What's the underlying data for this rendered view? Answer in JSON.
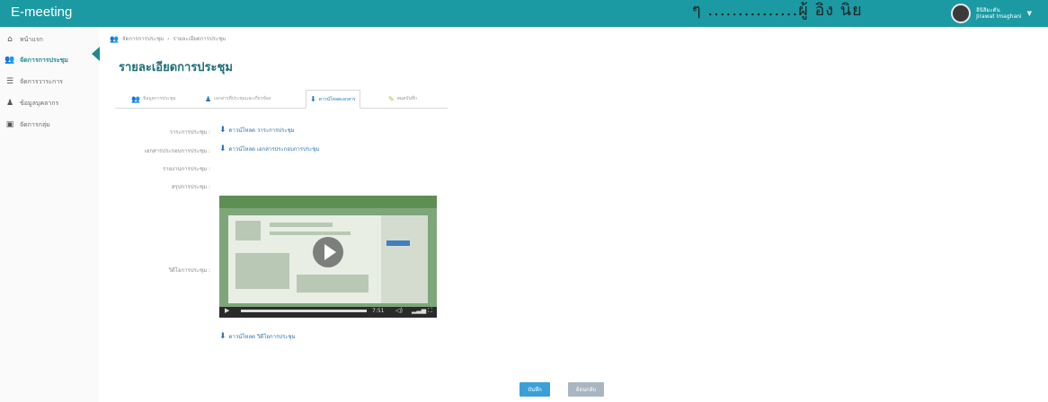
{
  "app": {
    "title": "E-meeting"
  },
  "scan_note": "ๆ    ...............ผู้ อิง   นิย",
  "user": {
    "line1": "อินิลิมะดัน",
    "line2": "Jirawat Imaghani"
  },
  "sidebar": {
    "items": [
      {
        "label": "หน้าแรก",
        "icon": "home-icon"
      },
      {
        "label": "จัดการการประชุม",
        "icon": "users-icon",
        "active": true
      },
      {
        "label": "จัดการวาระการ",
        "icon": "list-icon"
      },
      {
        "label": "ข้อมูลบุคลากร",
        "icon": "person-icon"
      },
      {
        "label": "จัดการกลุ่ม",
        "icon": "group-icon"
      }
    ]
  },
  "breadcrumb": {
    "root": "จัดการการประชุม",
    "sep": "›",
    "current": "รายละเอียดการประชุม"
  },
  "page": {
    "title": "รายละเอียดการประชุม"
  },
  "tabs": [
    {
      "label": "ข้อมูลการประชุม",
      "icon": "users-icon"
    },
    {
      "label": "เอกสารที่ประชุมและเกี่ยวข้อง",
      "icon": "person-icon"
    },
    {
      "label": "ดาวน์โหลดเอกสาร",
      "icon": "download-icon",
      "selected": true
    },
    {
      "label": "สมุดบันทึก",
      "icon": "note-icon"
    }
  ],
  "fields": {
    "agenda": {
      "label": "วาระการประชุม :",
      "link": "ดาวน์โหลด วาระการประชุม"
    },
    "meeting_docs": {
      "label": "เอกสารประกอบการประชุม :",
      "link": "ดาวน์โหลด เอกสารประกอบการประชุม"
    },
    "report": {
      "label": "รายงานการประชุม :"
    },
    "summary": {
      "label": "สรุปการประชุม :"
    },
    "video": {
      "label": "วิดีโอการประชุม :",
      "link": "ดาวน์โหลด วิดีโอการประชุม"
    }
  },
  "video_player": {
    "time": "7:51"
  },
  "buttons": {
    "save": "บันทึก",
    "back": "ย้อนกลับ"
  }
}
